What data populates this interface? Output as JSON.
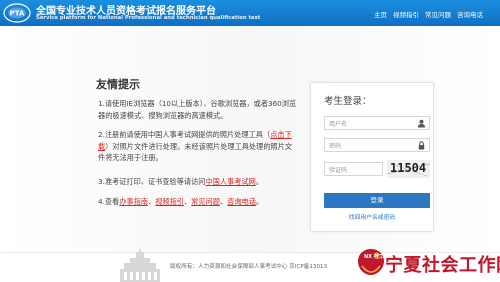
{
  "header": {
    "title": "全国专业技术人员资格考试报名服务平台",
    "subtitle": "Service platform for National Professional and technician qualification test",
    "logo_text": "PTA",
    "nav": [
      "主页",
      "视频指引",
      "常见问题",
      "咨询电话"
    ]
  },
  "tips": {
    "title": "友情提示",
    "item1": "1.请使用IE浏览器（10以上版本）、谷歌浏览器，或者360浏览器的极速模式、搜狗浏览器的高速模式。",
    "item2_pre": "2.注册前请使用中国人事考试网提供的照片处理工具（",
    "item2_link": "点击下载",
    "item2_post": "）对照片文件进行处理。未经该照片处理工具处理的照片文件将无法用于注册。",
    "item3_pre": "3.准考证打印、证书查验等请访问",
    "item3_link": "中国人事考试网",
    "item3_post": "。",
    "item4_pre": "4.查看",
    "item4_links": [
      "办事指南",
      "视频指引",
      "常见问题",
      "咨询电话"
    ],
    "item4_sep": "、",
    "item4_post": "。"
  },
  "login": {
    "title": "考生登录：",
    "username_placeholder": "用户名",
    "password_placeholder": "密码",
    "captcha_placeholder": "验证码",
    "captcha_code": "11504",
    "submit_label": "登录",
    "forgot_label": "找回用户名或密码"
  },
  "footer": {
    "copyright": "版权所有：人力资源和社会保障部人事考试中心 京ICP备13013"
  },
  "watermark": {
    "logo_text": "NX 社工",
    "text": "宁夏社会工作网"
  },
  "colors": {
    "header_blue": "#0e6fc3",
    "button_blue": "#2b77c4",
    "link_red": "#d9251d",
    "watermark_red": "#c0172c"
  }
}
